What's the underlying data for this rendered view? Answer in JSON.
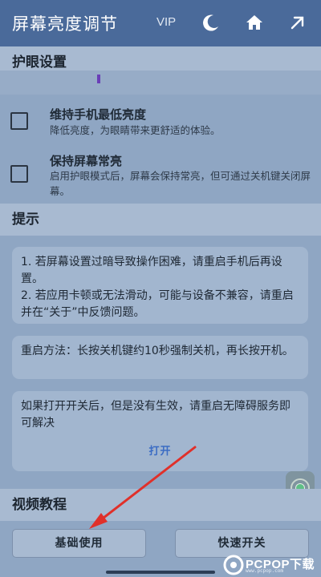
{
  "app_bar": {
    "title": "屏幕亮度调节",
    "vip_label": "VIP",
    "icons": [
      "moon-icon",
      "home-icon",
      "arrow-up-right-icon"
    ]
  },
  "eye_protection": {
    "header": "护眼设置",
    "settings": [
      {
        "title": "维持手机最低亮度",
        "description": "降低亮度，为眼睛带来更舒适的体验。",
        "checked": false
      },
      {
        "title": "保持屏幕常亮",
        "description": "启用护眼模式后，屏幕会保持常亮，但可通过关机键关闭屏幕。",
        "checked": false
      }
    ]
  },
  "tips": {
    "header": "提示",
    "card1": {
      "line1": "1. 若屏幕设置过暗导致操作困难，请重启手机后再设置。",
      "line2": "2. 若应用卡顿或无法滑动，可能与设备不兼容，请重启并在“关于”中反馈问题。"
    },
    "card2": {
      "text": "重启方法：长按关机键约10秒强制关机，再长按开机。"
    },
    "card3": {
      "text": "如果打开开关后，但是没有生效，请重启无障碍服务即可解决",
      "link": "打开"
    }
  },
  "video_tutorial": {
    "header": "视频教程",
    "buttons": {
      "basic": "基础使用",
      "quick": "快速开关"
    }
  },
  "watermark": {
    "brand": "PCPOP下载",
    "sub": "www.pcpop.com"
  },
  "colors": {
    "app_bar": "#4a6a9a",
    "background": "#8fa6c3",
    "accent_link": "#3b6cc4",
    "annotation": "#e0302a"
  }
}
